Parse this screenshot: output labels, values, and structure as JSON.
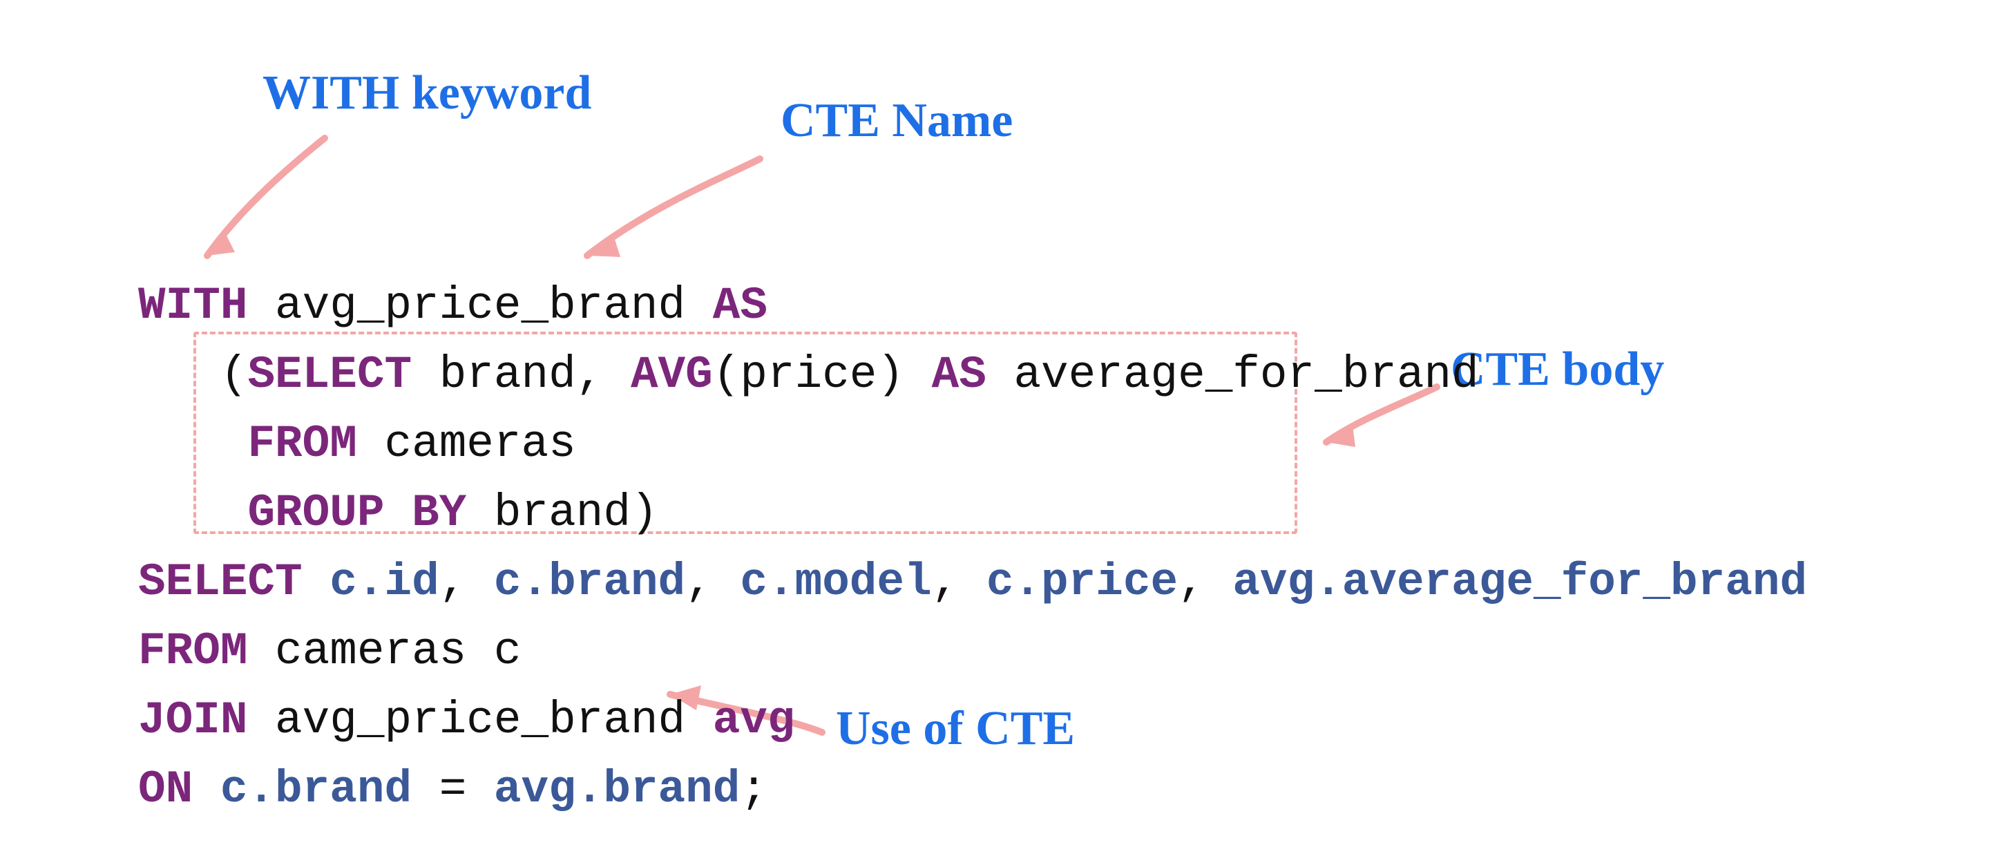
{
  "annotations": {
    "with_keyword": "WITH keyword",
    "cte_name": "CTE Name",
    "cte_body": "CTE body",
    "use_of_cte": "Use of CTE"
  },
  "code": {
    "line1": {
      "with": "WITH ",
      "name": "avg_price_brand ",
      "as": "AS"
    },
    "line2": {
      "indent": "   (",
      "select": "SELECT ",
      "col1": "brand, ",
      "avg": "AVG",
      "paren_price": "(price) ",
      "as": "AS ",
      "alias": "average_for_brand"
    },
    "line3": {
      "indent": "    ",
      "from": "FROM ",
      "tbl": "cameras"
    },
    "line4": {
      "indent": "    ",
      "group": "GROUP ",
      "by": "BY ",
      "col": "brand)"
    },
    "line5": {
      "select": "SELECT ",
      "cols": "c.id, c.brand, c.model, c.price, avg.average_for_brand",
      "c_id": "c.id",
      "sep1": ", ",
      "c_brand": "c.brand",
      "sep2": ", ",
      "c_model": "c.model",
      "sep3": ", ",
      "c_price": "c.price",
      "sep4": ", ",
      "avg_col": "avg.average_for_brand"
    },
    "line6": {
      "from": "FROM ",
      "tbl": "cameras c"
    },
    "line7": {
      "join": "JOIN ",
      "tbl": "avg_price_brand ",
      "alias": "avg"
    },
    "line8": {
      "on": "ON ",
      "left": "c.brand ",
      "eq": "= ",
      "right": "avg.brand",
      "semi": ";"
    }
  }
}
